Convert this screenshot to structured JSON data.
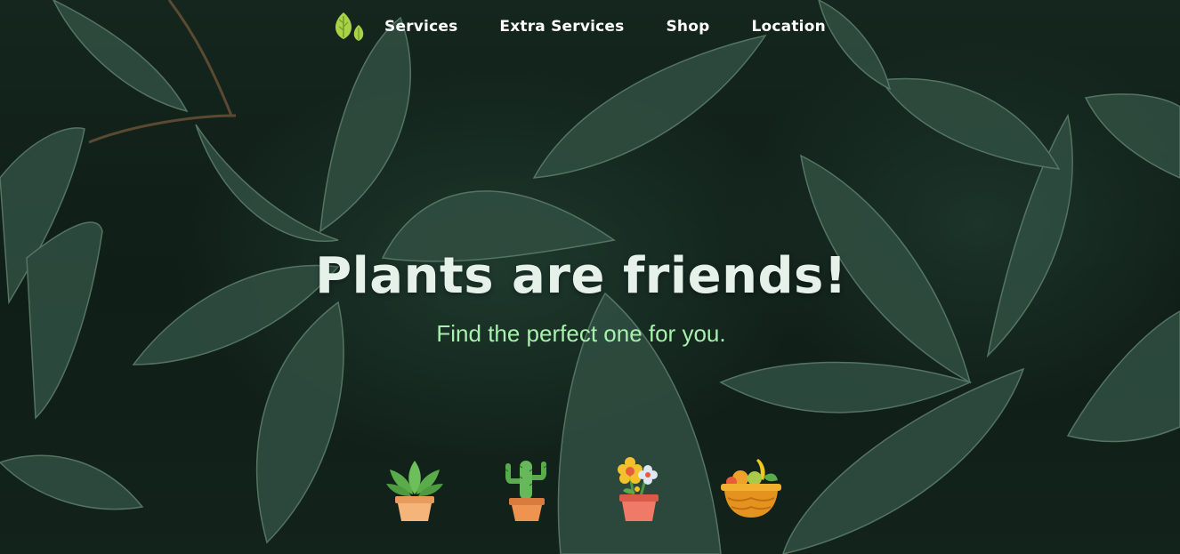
{
  "nav": {
    "logo_icon": "leaf-logo-icon",
    "links": [
      {
        "label": "Services"
      },
      {
        "label": "Extra Services"
      },
      {
        "label": "Shop"
      },
      {
        "label": "Location"
      }
    ]
  },
  "hero": {
    "title": "Plants are friends!",
    "subtitle": "Find the perfect one for you."
  },
  "plants": [
    {
      "icon": "succulent-pot-icon"
    },
    {
      "icon": "cactus-pot-icon"
    },
    {
      "icon": "flower-pot-icon"
    },
    {
      "icon": "fruit-basket-icon"
    }
  ],
  "colors": {
    "title": "#e6f1e9",
    "subtitle": "#a8f0ad",
    "nav_text": "#ffffff",
    "logo": "#a9d247"
  }
}
